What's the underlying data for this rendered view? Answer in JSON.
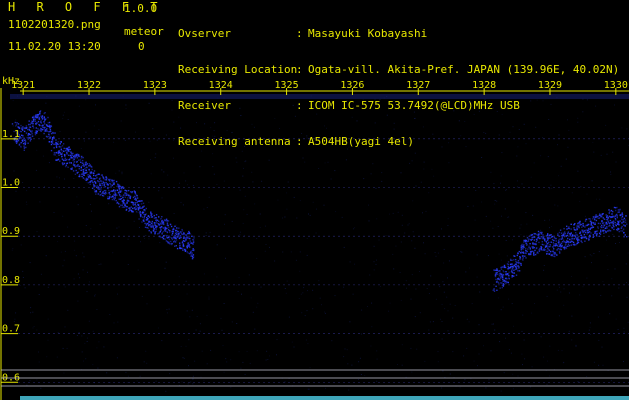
{
  "header": {
    "app_title": "H R O F F T",
    "app_version": "1.0.0",
    "filename": "1102201320.png",
    "datetime": "11.02.20 13:20",
    "meteor_label": "meteor",
    "meteor_count": "0",
    "info": [
      {
        "key": "Ovserver",
        "sep": ":",
        "value": "Masayuki Kobayashi"
      },
      {
        "key": "Receiving Location",
        "sep": ":",
        "value": "Ogata-vill. Akita-Pref. JAPAN (139.96E, 40.02N)"
      },
      {
        "key": "Receiver",
        "sep": ":",
        "value": "ICOM IC-575 53.7492(@LCD)MHz USB"
      },
      {
        "key": "Receiving antenna",
        "sep": ":",
        "value": "A504HB(yagi 4el)"
      }
    ]
  },
  "chart_data": {
    "type": "heatmap",
    "xlabel": "",
    "ylabel": "kHz",
    "x_ticks": [
      "1321",
      "1322",
      "1323",
      "1324",
      "1325",
      "1326",
      "1327",
      "1328",
      "1329",
      "1330"
    ],
    "y_ticks": [
      "1.1",
      "1.0",
      "0.9",
      "0.8",
      "0.7",
      "0.6"
    ],
    "y_tick_values": [
      1.1,
      1.0,
      0.9,
      0.8,
      0.7,
      0.6
    ],
    "x_range": [
      1320.8,
      1330.2
    ],
    "y_range": [
      0.58,
      1.19
    ],
    "trace_points": [
      {
        "x": 1320.85,
        "y": 1.12
      },
      {
        "x": 1321.0,
        "y": 1.1
      },
      {
        "x": 1321.15,
        "y": 1.13
      },
      {
        "x": 1321.3,
        "y": 1.14
      },
      {
        "x": 1321.5,
        "y": 1.08
      },
      {
        "x": 1321.7,
        "y": 1.06
      },
      {
        "x": 1321.9,
        "y": 1.04
      },
      {
        "x": 1322.1,
        "y": 1.01
      },
      {
        "x": 1322.3,
        "y": 1.0
      },
      {
        "x": 1322.5,
        "y": 0.98
      },
      {
        "x": 1322.7,
        "y": 0.97
      },
      {
        "x": 1322.9,
        "y": 0.93
      },
      {
        "x": 1323.1,
        "y": 0.92
      },
      {
        "x": 1323.3,
        "y": 0.9
      },
      {
        "x": 1323.5,
        "y": 0.89
      },
      {
        "x": 1323.6,
        "y": 0.87
      },
      {
        "x": 1328.15,
        "y": 0.81
      },
      {
        "x": 1328.3,
        "y": 0.82
      },
      {
        "x": 1328.45,
        "y": 0.84
      },
      {
        "x": 1328.65,
        "y": 0.88
      },
      {
        "x": 1328.85,
        "y": 0.89
      },
      {
        "x": 1329.05,
        "y": 0.88
      },
      {
        "x": 1329.25,
        "y": 0.9
      },
      {
        "x": 1329.45,
        "y": 0.91
      },
      {
        "x": 1329.65,
        "y": 0.92
      },
      {
        "x": 1329.85,
        "y": 0.93
      },
      {
        "x": 1330.0,
        "y": 0.94
      },
      {
        "x": 1330.15,
        "y": 0.92
      }
    ],
    "colors": {
      "axis": "#e8e800",
      "trace": "#2a3cff",
      "background": "#000000",
      "grid": "#2a2a7a",
      "hline": "#c8c8d8"
    }
  }
}
